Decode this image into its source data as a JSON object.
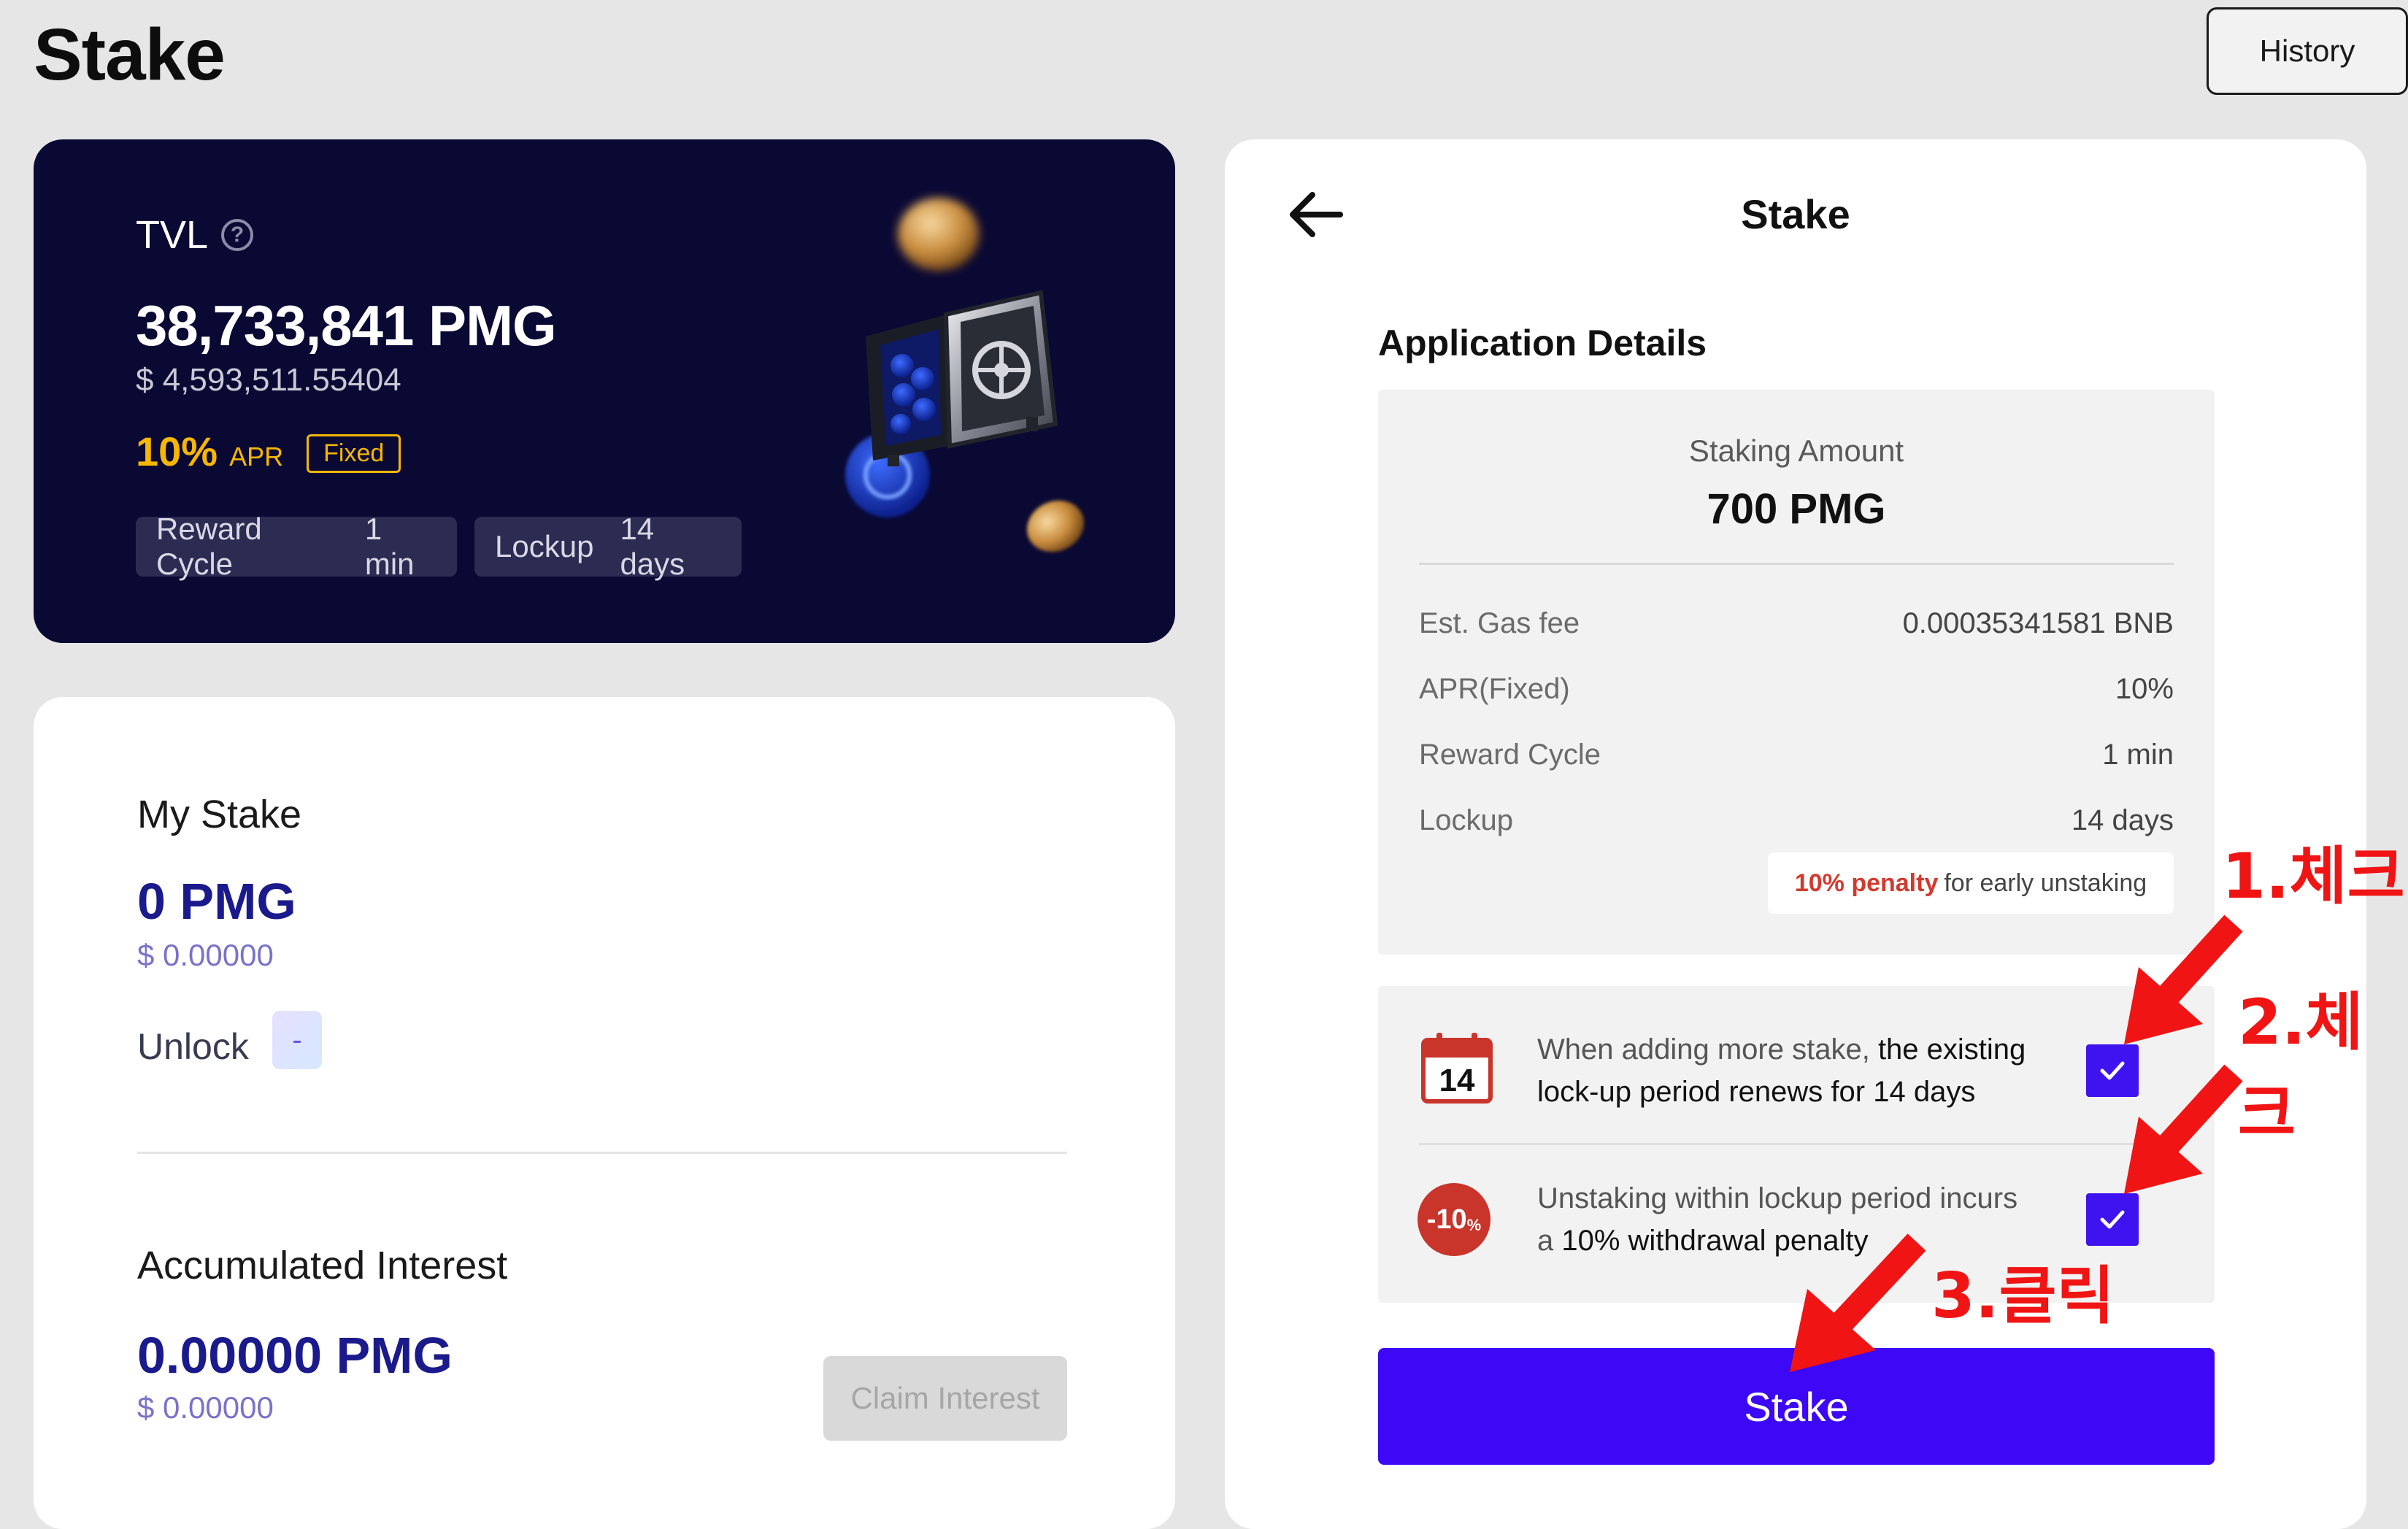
{
  "header": {
    "title": "Stake",
    "history_label": "History"
  },
  "tvl": {
    "label": "TVL",
    "amount": "38,733,841 PMG",
    "usd": "$ 4,593,511.55404",
    "apr_value": "10%",
    "apr_label": "APR",
    "fixed_label": "Fixed",
    "chips": [
      {
        "label": "Reward Cycle",
        "value": "1 min"
      },
      {
        "label": "Lockup",
        "value": "14 days"
      }
    ]
  },
  "my_stake": {
    "title": "My Stake",
    "amount": "0 PMG",
    "usd": "$ 0.00000",
    "unlock_label": "Unlock",
    "unlock_value": "-",
    "accumulated_title": "Accumulated Interest",
    "accumulated_amount": "0.00000 PMG",
    "accumulated_usd": "$ 0.00000",
    "claim_label": "Claim Interest"
  },
  "stake_panel": {
    "title": "Stake",
    "section_title": "Application Details",
    "staking_amount_label": "Staking Amount",
    "staking_amount_value": "700 PMG",
    "rows": [
      {
        "key": "Est. Gas fee",
        "value": "0.00035341581 BNB"
      },
      {
        "key": "APR(Fixed)",
        "value": "10%"
      },
      {
        "key": "Reward Cycle",
        "value": "1 min"
      },
      {
        "key": "Lockup",
        "value": "14 days"
      }
    ],
    "penalty_highlight": "10% penalty",
    "penalty_rest": "for early unstaking",
    "calendar_number": "14",
    "penalty_icon_text": "-10",
    "penalty_icon_sub": "%",
    "confirm1_plain": "When adding more stake,",
    "confirm1_bold": "the existing lock-up period renews for 14 days",
    "confirm1_checked": true,
    "confirm2_plain": "Unstaking within lockup period incurs a",
    "confirm2_bold": "10% withdrawal penalty",
    "confirm2_checked": true,
    "stake_button": "Stake"
  },
  "annotations": {
    "step1": "1.체크",
    "step2": "2.체크",
    "step3": "3.클릭",
    "color": "#f01414"
  },
  "colors": {
    "accent": "#3d08f5",
    "tvl_bg": "#0a0934",
    "apr_gold": "#f5b700",
    "amount_navy": "#1b1a8c",
    "penalty_red": "#d13a2e"
  }
}
